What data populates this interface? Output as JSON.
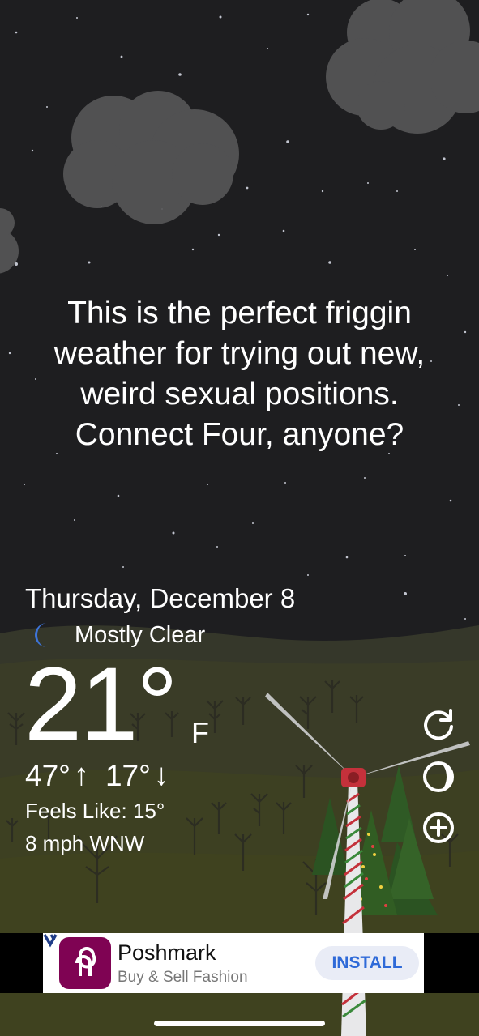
{
  "quote": "This is the perfect friggin weather for trying out new, weird sexual positions. Connect Four, anyone?",
  "date": "Thursday, December 8",
  "condition": {
    "icon": "crescent-moon-icon",
    "text": "Mostly Clear"
  },
  "temperature": {
    "value": "21°",
    "unit": "F"
  },
  "high": "47°",
  "low": "17°",
  "feels_like": "Feels Like: 15°",
  "wind": "8 mph WNW",
  "side_buttons": [
    "refresh-icon",
    "moon-phase-icon",
    "add-location-icon"
  ],
  "ad": {
    "app_name": "Poshmark",
    "tagline": "Buy & Sell Fashion",
    "cta": "INSTALL"
  },
  "colors": {
    "sky": "#1e1e20",
    "hill": "#3a3d28",
    "moon": "#3d74d9",
    "ad_cta": "#2f6ad8",
    "poshmark": "#7f0353"
  }
}
